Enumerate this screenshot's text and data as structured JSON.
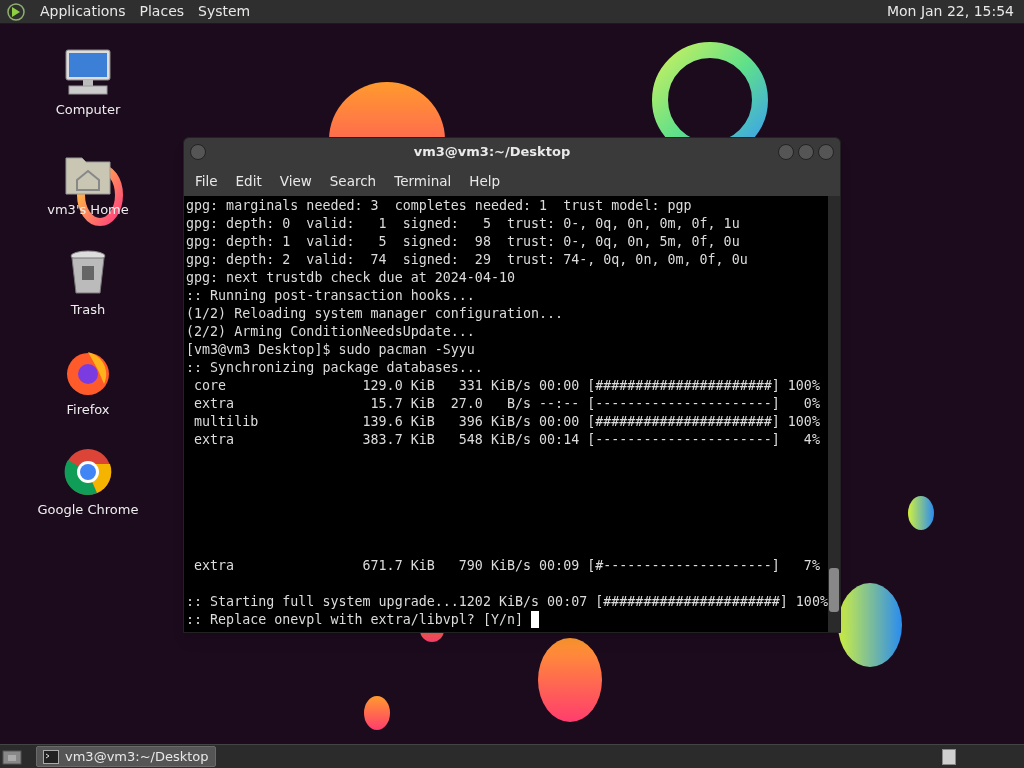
{
  "top_panel": {
    "menus": [
      "Applications",
      "Places",
      "System"
    ],
    "clock": "Mon Jan 22, 15:54"
  },
  "desktop_icons": [
    {
      "kind": "computer",
      "label": "Computer"
    },
    {
      "kind": "home",
      "label": "vm3's Home"
    },
    {
      "kind": "trash",
      "label": "Trash"
    },
    {
      "kind": "firefox",
      "label": "Firefox"
    },
    {
      "kind": "chrome",
      "label": "Google Chrome"
    }
  ],
  "window": {
    "title": "vm3@vm3:~/Desktop",
    "menu": [
      "File",
      "Edit",
      "View",
      "Search",
      "Terminal",
      "Help"
    ],
    "terminal_lines": [
      {
        "kind": "text",
        "text": "gpg: marginals needed: 3  completes needed: 1  trust model: pgp"
      },
      {
        "kind": "text",
        "text": "gpg: depth: 0  valid:   1  signed:   5  trust: 0-, 0q, 0n, 0m, 0f, 1u"
      },
      {
        "kind": "text",
        "text": "gpg: depth: 1  valid:   5  signed:  98  trust: 0-, 0q, 0n, 5m, 0f, 0u"
      },
      {
        "kind": "text",
        "text": "gpg: depth: 2  valid:  74  signed:  29  trust: 74-, 0q, 0n, 0m, 0f, 0u"
      },
      {
        "kind": "text",
        "text": "gpg: next trustdb check due at 2024-04-10"
      },
      {
        "kind": "text",
        "text": ":: Running post-transaction hooks..."
      },
      {
        "kind": "text",
        "text": "(1/2) Reloading system manager configuration..."
      },
      {
        "kind": "text",
        "text": "(2/2) Arming ConditionNeedsUpdate..."
      },
      {
        "kind": "text",
        "text": "[vm3@vm3 Desktop]$ sudo pacman -Syyu"
      },
      {
        "kind": "text",
        "text": ":: Synchronizing package databases..."
      },
      {
        "kind": "text",
        "text": " core                 129.0 KiB   331 KiB/s 00:00 [######################] 100%"
      },
      {
        "kind": "text",
        "text": " extra                 15.7 KiB  27.0   B/s --:-- [----------------------]   0%"
      },
      {
        "kind": "text",
        "text": " multilib             139.6 KiB   396 KiB/s 00:00 [######################] 100%"
      },
      {
        "kind": "text",
        "text": " extra                383.7 KiB   548 KiB/s 00:14 [----------------------]   4%"
      },
      {
        "kind": "blank"
      },
      {
        "kind": "blank"
      },
      {
        "kind": "blank"
      },
      {
        "kind": "blank"
      },
      {
        "kind": "blank"
      },
      {
        "kind": "blank"
      },
      {
        "kind": "text",
        "text": " extra                671.7 KiB   790 KiB/s 00:09 [#---------------------]   7%"
      },
      {
        "kind": "blank"
      },
      {
        "kind": "text",
        "text": ":: Starting full system upgrade...1202 KiB/s 00:07 [######################] 100%"
      },
      {
        "kind": "prompt",
        "text": ":: Replace onevpl with extra/libvpl? [Y/n] "
      }
    ]
  },
  "taskbar": {
    "tasks": [
      {
        "label": "vm3@vm3:~/Desktop",
        "selected": true
      }
    ]
  }
}
